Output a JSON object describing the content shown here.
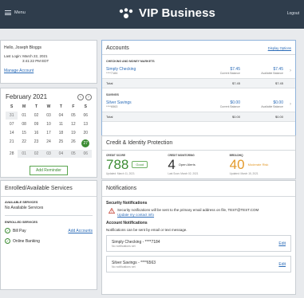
{
  "header": {
    "menu_label": "Menu",
    "brand": "VIP Business",
    "logout_label": "Logout"
  },
  "welcome": {
    "greeting": "Hello, Joseph Bloggs",
    "last_login_label": "Last Login: March 22, 2021",
    "last_login_time": "3:41:22 PM EDT",
    "manage_link": "Manage Account"
  },
  "calendar": {
    "month": "February 2021",
    "prev_icon": "chevron-left-icon",
    "next_icon": "chevron-right-icon",
    "dow": [
      "S",
      "M",
      "T",
      "W",
      "T",
      "F",
      "S"
    ],
    "weeks": [
      [
        "31",
        "01",
        "02",
        "03",
        "04",
        "05",
        "06"
      ],
      [
        "07",
        "08",
        "09",
        "10",
        "11",
        "12",
        "13"
      ],
      [
        "14",
        "15",
        "16",
        "17",
        "18",
        "19",
        "20"
      ],
      [
        "21",
        "22",
        "23",
        "24",
        "25",
        "26",
        "27"
      ],
      [
        "28",
        "01",
        "02",
        "03",
        "04",
        "05",
        "06"
      ]
    ],
    "today": "27",
    "reminder_button": "Add Reminder"
  },
  "services": {
    "title": "Enrolled/Available Services",
    "available_head": "AVAILABLE SERVICES",
    "available_none": "No Available Services",
    "enrolled_head": "ENROLLED SERVICES",
    "enrolled": [
      {
        "name": "Bill Pay",
        "link": "Add Accounts"
      },
      {
        "name": "Online Banking",
        "link": ""
      }
    ]
  },
  "accounts": {
    "title": "Accounts",
    "options_link": "Display Options",
    "sections": [
      {
        "head": "CHECKING AND MONEY MARKETS",
        "name": "Simply Checking",
        "number": "****7184",
        "current": "$7.45",
        "current_label": "Current Balance",
        "available": "$7.45",
        "available_label": "Available Balance",
        "total_label": "Total",
        "total_current": "$7.45",
        "total_available": "$7.45"
      },
      {
        "head": "SAVINGS",
        "name": "Silver Savings",
        "number": "****6563",
        "current": "$0.00",
        "current_label": "Current Balance",
        "available": "$0.00",
        "available_label": "Available Balance",
        "total_label": "Total",
        "total_current": "$0.00",
        "total_available": "$0.00"
      }
    ]
  },
  "credit": {
    "title": "Credit & Identity Protection",
    "score_head": "CREDIT SCORE",
    "score": "788",
    "score_badge": "Good",
    "score_foot": "Updated: March 11, 2021",
    "monitor_head": "CREDIT MONITORING",
    "monitor_count": "4",
    "monitor_label": "Open Alerts",
    "monitor_foot": "Last Scan: March 02, 2021",
    "breach_head": "BREACHIQ",
    "breach_count": "40",
    "breach_label": "Moderate Risk",
    "breach_foot": "Updated: March 15, 2021",
    "colors": {
      "good": "#3c8c33",
      "moderate": "#e39a2b"
    }
  },
  "notifications": {
    "title": "Notifications",
    "security_title": "Security Notifications",
    "security_text": "Security notifications will be sent to the primary email address on file, TEST@TEST.COM",
    "security_link": "Update my contact info",
    "account_title": "Account Notifications",
    "account_text": "Notifications can be sent by email or text message.",
    "items": [
      {
        "name": "Simply Checking - ****7184",
        "status": "No notifications set",
        "edit": "Edit"
      },
      {
        "name": "Silver Savings - ****6563",
        "status": "No notifications set",
        "edit": "Edit"
      }
    ]
  }
}
